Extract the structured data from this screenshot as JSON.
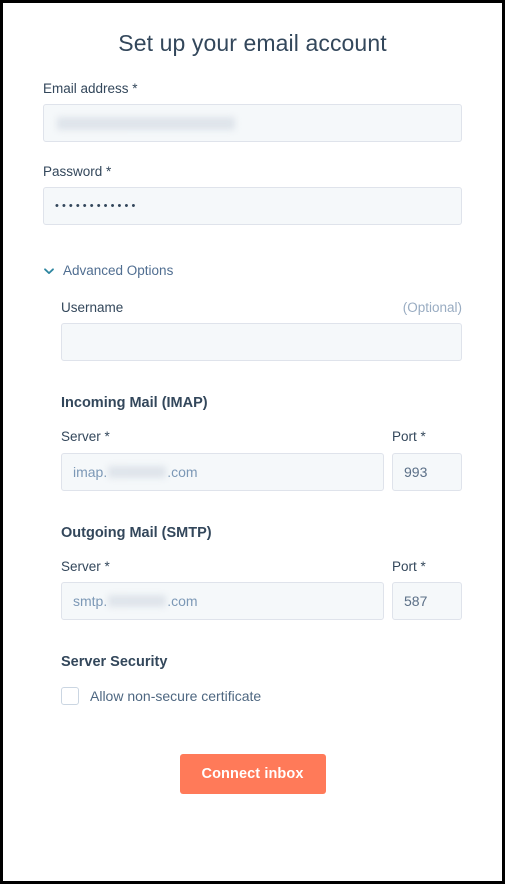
{
  "page": {
    "title": "Set up your email account"
  },
  "email": {
    "label": "Email address *",
    "value": "",
    "value_redacted": true
  },
  "password": {
    "label": "Password *",
    "masked_value": "••••••••••••",
    "dot_count": 12
  },
  "advanced": {
    "toggle_label": "Advanced Options",
    "expanded": true,
    "chevron_icon": "chevron-down-icon",
    "chevron_color": "#2e86a0",
    "username": {
      "label": "Username",
      "optional_label": "(Optional)",
      "value": "",
      "placeholder": ""
    },
    "incoming": {
      "heading": "Incoming Mail (IMAP)",
      "server_label": "Server *",
      "server_prefix": "imap.",
      "server_suffix": ".com",
      "server_redacted": true,
      "port_label": "Port *",
      "port_value": "993"
    },
    "outgoing": {
      "heading": "Outgoing Mail (SMTP)",
      "server_label": "Server *",
      "server_prefix": "smtp.",
      "server_suffix": ".com",
      "server_redacted": true,
      "port_label": "Port *",
      "port_value": "587"
    },
    "security": {
      "heading": "Server Security",
      "checkbox_label": "Allow non-secure certificate",
      "checked": false
    }
  },
  "submit": {
    "label": "Connect inbox",
    "color": "#ff7a59",
    "text_color": "#ffffff"
  },
  "colors": {
    "text_primary": "#33475b",
    "text_muted": "#7c98b6",
    "field_bg": "#f5f8fa",
    "field_border": "#dfe3eb",
    "accent_orange": "#ff7a59",
    "accent_teal": "#2e86a0"
  }
}
